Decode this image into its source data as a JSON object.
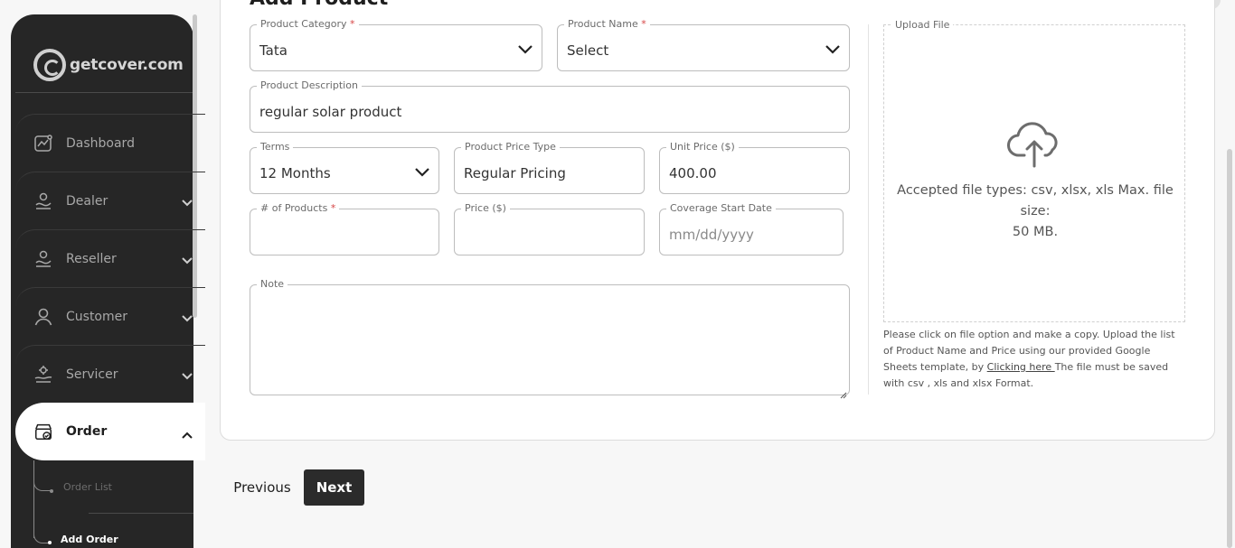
{
  "brand": {
    "logo_text": "getcover.com"
  },
  "sidebar": {
    "items": [
      {
        "label": "Dashboard",
        "icon": "dashboard-chart-icon"
      },
      {
        "label": "Dealer",
        "icon": "dealer-icon"
      },
      {
        "label": "Reseller",
        "icon": "reseller-icon"
      },
      {
        "label": "Customer",
        "icon": "user-icon"
      },
      {
        "label": "Servicer",
        "icon": "servicer-icon"
      },
      {
        "label": "Order",
        "icon": "order-icon"
      }
    ],
    "submenu": [
      {
        "label": "Order List"
      },
      {
        "label": "Add Order"
      }
    ]
  },
  "form": {
    "title": "Add Product",
    "product_category": {
      "label": "Product Category",
      "required": "*",
      "value": "Tata"
    },
    "product_name": {
      "label": "Product Name",
      "required": "*",
      "value": "Select"
    },
    "product_description": {
      "label": "Product Description",
      "value": "regular solar product"
    },
    "terms": {
      "label": "Terms",
      "value": "12 Months"
    },
    "price_type": {
      "label": "Product Price Type",
      "value": "Regular Pricing"
    },
    "unit_price": {
      "label": "Unit Price ($)",
      "value": "400.00"
    },
    "num_products": {
      "label": "# of Products",
      "required": "*",
      "value": ""
    },
    "price": {
      "label": "Price ($)",
      "value": ""
    },
    "coverage_start": {
      "label": "Coverage Start Date",
      "placeholder": "mm/dd/yyyy"
    },
    "note": {
      "label": "Note",
      "value": ""
    }
  },
  "upload": {
    "label": "Upload File",
    "accepted_line1": "Accepted file types: csv, xlsx, xls Max. file size:",
    "accepted_line2": "50 MB.",
    "help_before": "Please click on file option and make a copy. Upload the list of Product Name and Price using our provided Google Sheets template, by ",
    "help_link": "Clicking here ",
    "help_after": "The file must be saved with csv , xls and xlsx Format."
  },
  "actions": {
    "previous": "Previous",
    "next": "Next"
  },
  "colors": {
    "sidebar_bg": "#262626",
    "primary_button": "#2b2b2b",
    "required": "#d64545"
  }
}
